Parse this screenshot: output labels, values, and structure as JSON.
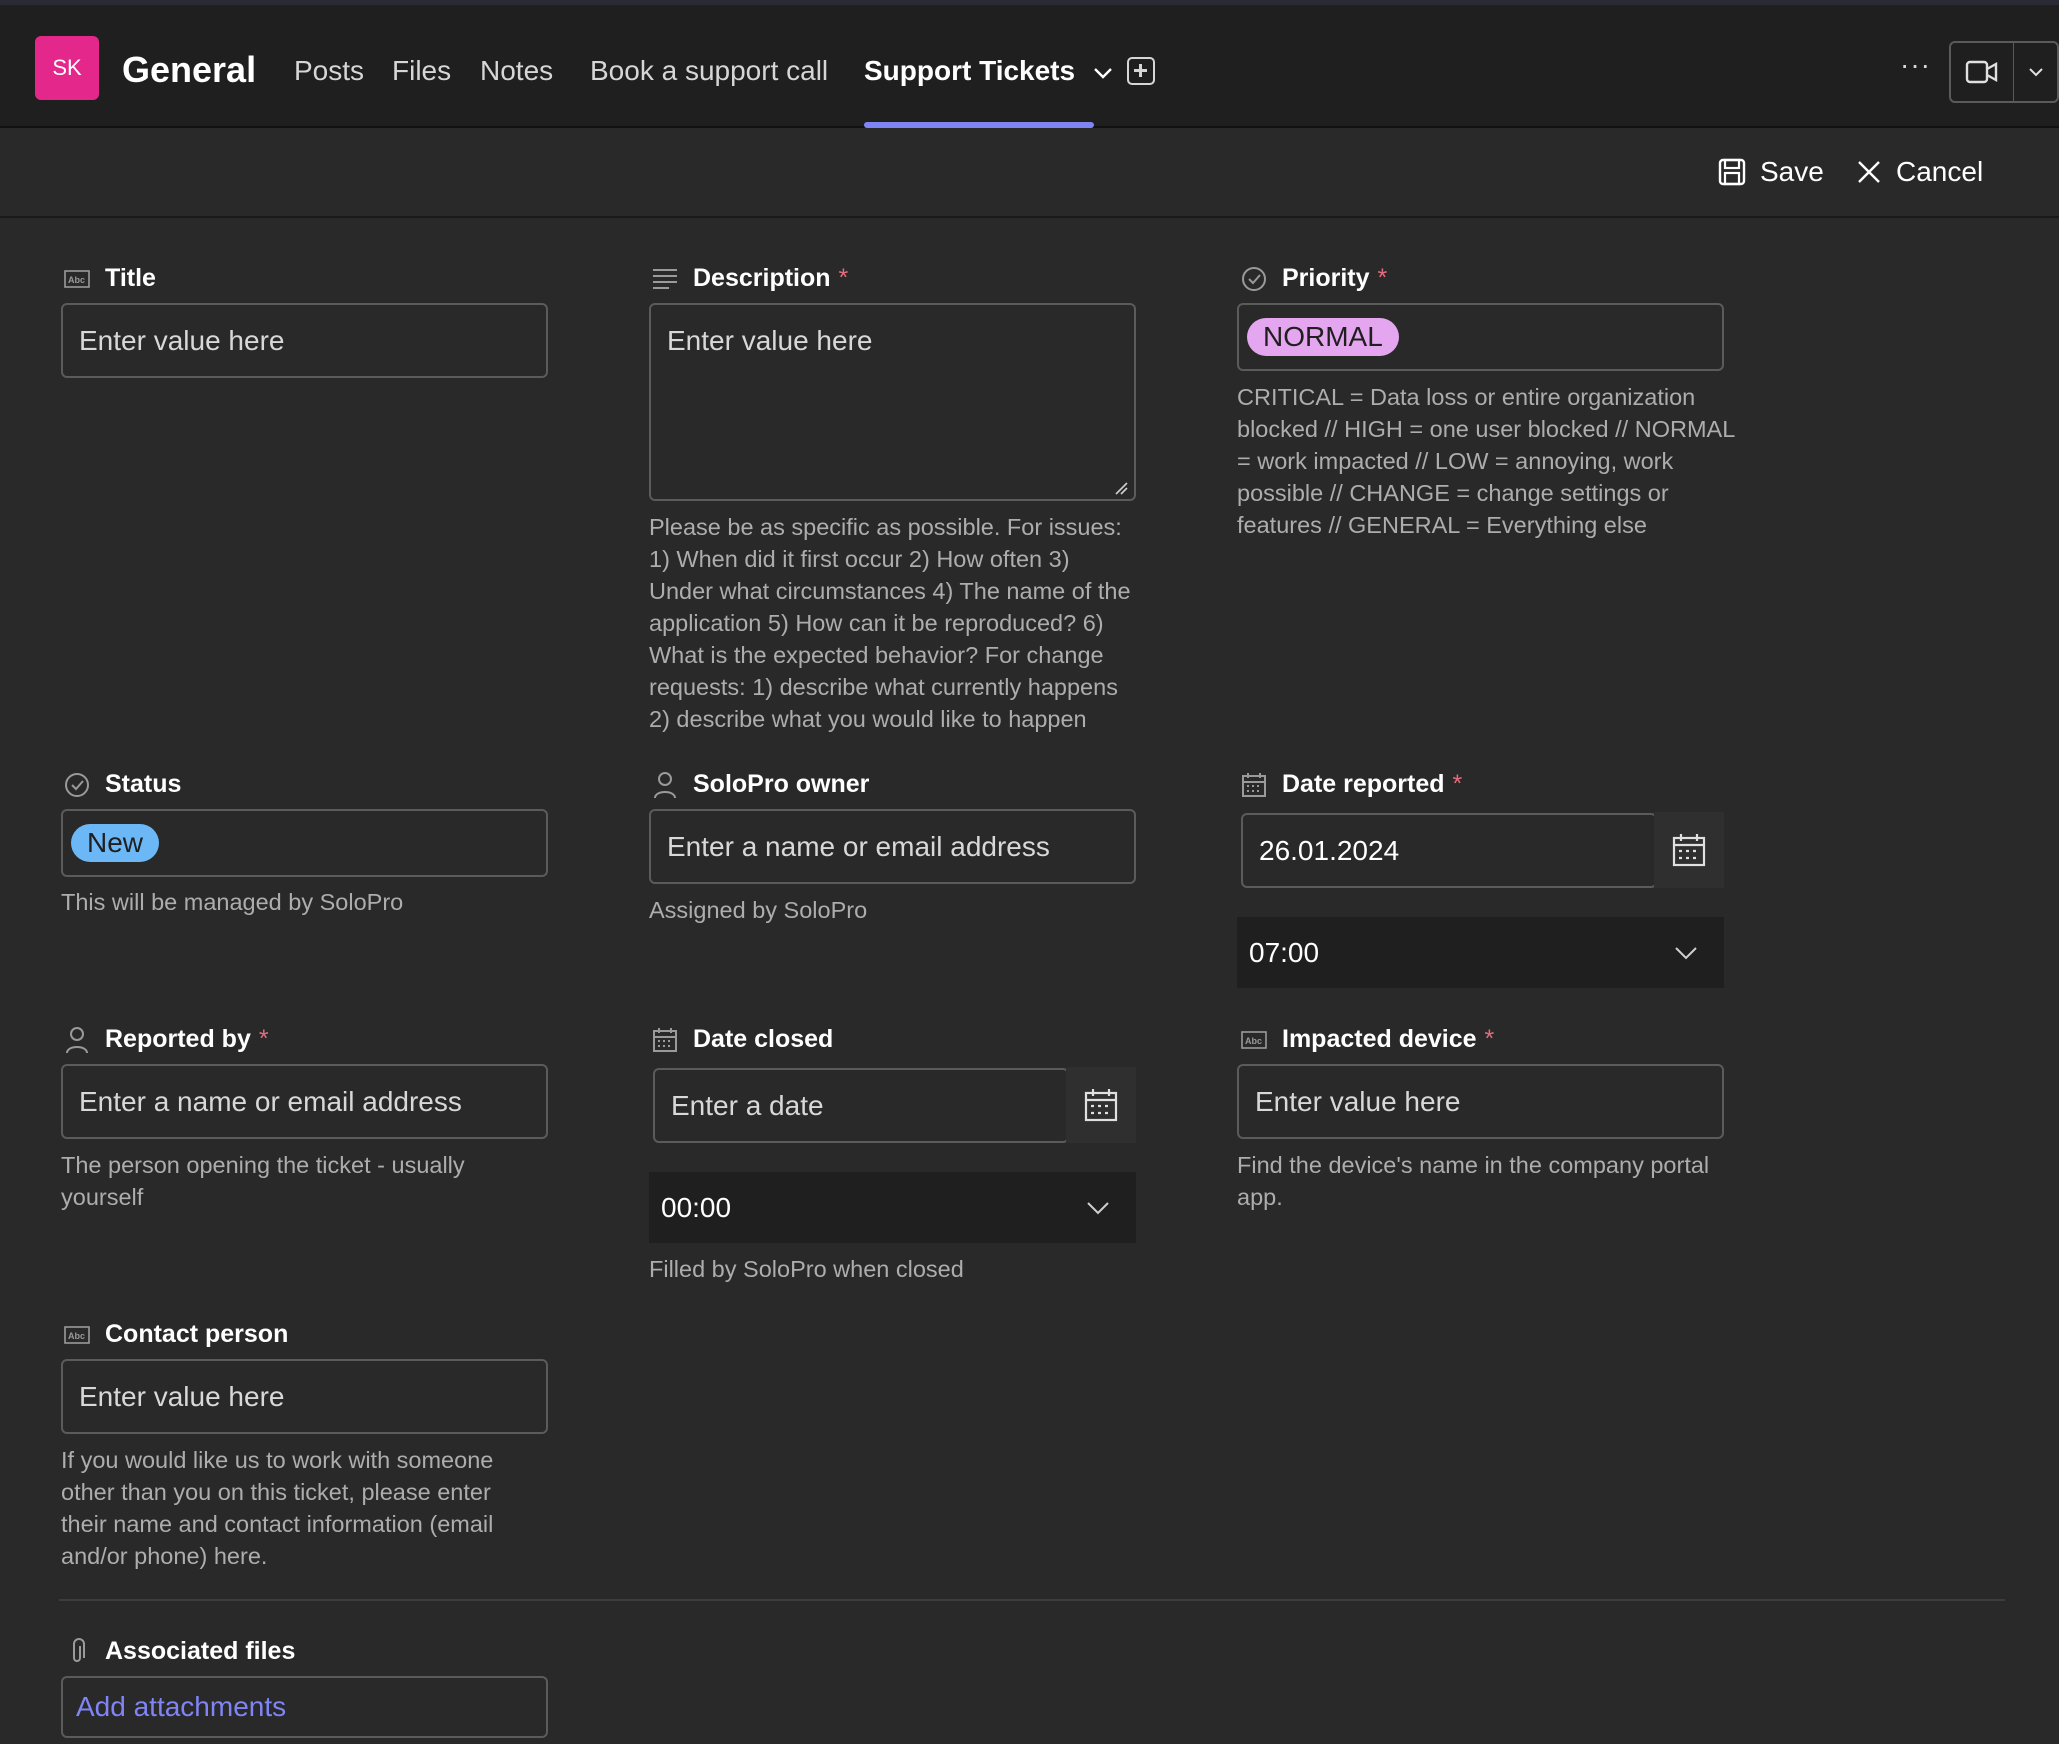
{
  "header": {
    "avatar_initials": "SK",
    "channel_title": "General",
    "tabs": [
      {
        "label": "Posts"
      },
      {
        "label": "Files"
      },
      {
        "label": "Notes"
      },
      {
        "label": "Book a support call"
      },
      {
        "label": "Support Tickets"
      }
    ],
    "more_label": "···"
  },
  "commands": {
    "save_label": "Save",
    "cancel_label": "Cancel"
  },
  "form": {
    "title": {
      "label": "Title",
      "placeholder": "Enter value here"
    },
    "description": {
      "label": "Description",
      "required_mark": "*",
      "placeholder": "Enter value here",
      "helper": "Please be as specific as possible. For issues: 1) When did it first occur 2) How often 3) Under what circumstances 4) The name of the application 5) How can it be reproduced? 6) What is the expected behavior? For change requests: 1) describe what currently happens 2) describe what you would like to happen"
    },
    "priority": {
      "label": "Priority",
      "required_mark": "*",
      "value": "NORMAL",
      "helper": "CRITICAL = Data loss or entire organization blocked // HIGH = one user blocked // NORMAL = work impacted // LOW = annoying, work possible // CHANGE = change settings or features // GENERAL = Everything else"
    },
    "status": {
      "label": "Status",
      "value": "New",
      "helper": "This will be managed by SoloPro"
    },
    "owner": {
      "label": "SoloPro owner",
      "placeholder": "Enter a name or email address",
      "helper": "Assigned by SoloPro"
    },
    "date_reported": {
      "label": "Date reported",
      "required_mark": "*",
      "date": "26.01.2024",
      "time": "07:00"
    },
    "reported_by": {
      "label": "Reported by",
      "required_mark": "*",
      "placeholder": "Enter a name or email address",
      "helper": "The person opening the ticket - usually yourself"
    },
    "date_closed": {
      "label": "Date closed",
      "placeholder": "Enter a date",
      "time": "00:00",
      "helper": "Filled by SoloPro when closed"
    },
    "impacted_device": {
      "label": "Impacted device",
      "required_mark": "*",
      "placeholder": "Enter value here",
      "helper": "Find the device's name in the company portal app."
    },
    "contact_person": {
      "label": "Contact person",
      "placeholder": "Enter value here",
      "helper": "If you would like us to work with someone other than you on this ticket, please enter their name and contact information (email and/or phone) here."
    },
    "associated_files": {
      "label": "Associated files",
      "link": "Add attachments"
    }
  },
  "colors": {
    "brand_avatar": "#e3278b",
    "accent": "#7f85f5",
    "priority_pill": "#e4a6ee",
    "status_pill": "#6cb8f6",
    "required": "#e46c7c"
  }
}
